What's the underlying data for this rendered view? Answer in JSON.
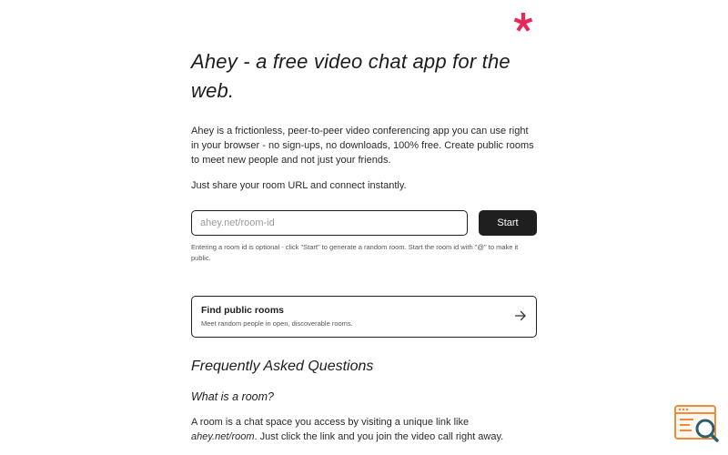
{
  "brand": {
    "logo_icon": "asterisk-icon",
    "accent_color": "#e8285a"
  },
  "hero": {
    "title": "Ahey - a free video chat app for the web.",
    "intro": "Ahey is a frictionless, peer-to-peer video conferencing app you can use right in your browser - no sign-ups, no downloads, 100% free. Create public rooms to meet new people and not just your friends.",
    "share_text": "Just share your room URL and connect instantly."
  },
  "room_form": {
    "input_placeholder": "ahey.net/room-id",
    "input_value": "",
    "start_label": "Start",
    "hint": "Entering a room id is optional - click \"Start\" to generate a random room. Start the room id with \"@\" to make it public."
  },
  "public_rooms": {
    "title": "Find public rooms",
    "subtitle": "Meet random people in open, discoverable rooms.",
    "icon": "arrow-right-icon"
  },
  "faq": {
    "heading": "Frequently Asked Questions",
    "items": [
      {
        "question": "What is a room?",
        "answer_before": "A room is a chat space you access by visiting a unique link like ",
        "answer_link": "ahey.net/room",
        "answer_after": ". Just click the link and you join the video call right away."
      }
    ]
  },
  "corner_widget": {
    "icon": "browser-search-icon",
    "color": "#f08a3c"
  }
}
